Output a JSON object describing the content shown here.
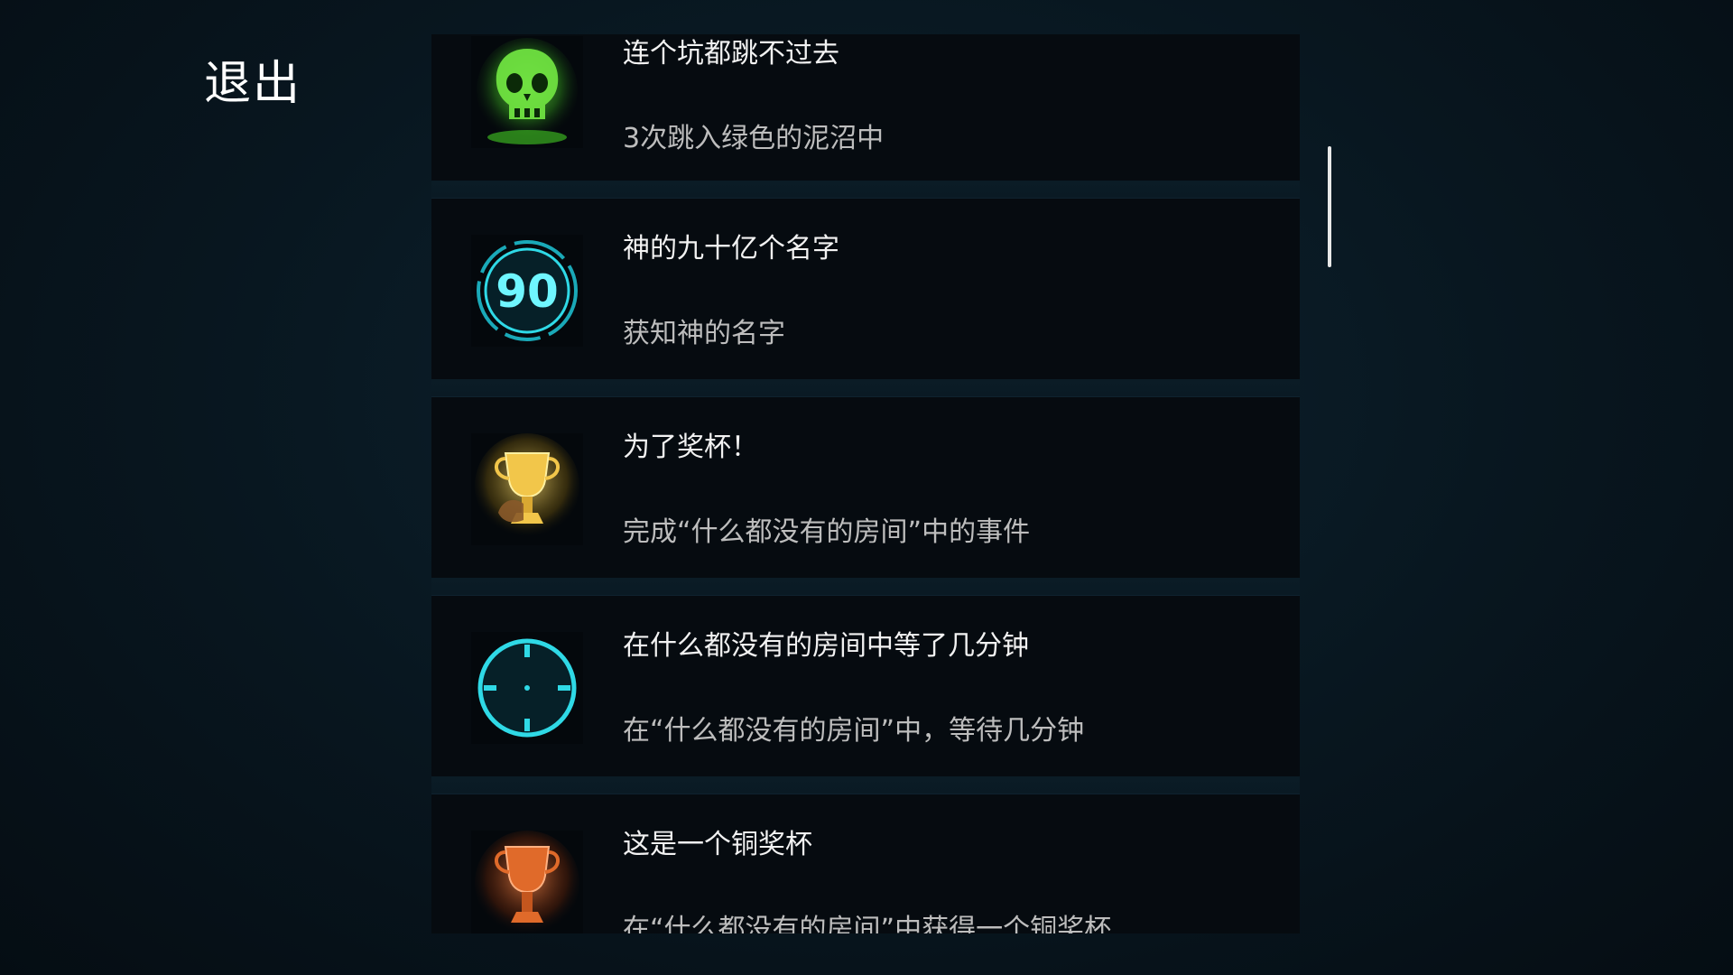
{
  "header": {
    "exit_label": "退出"
  },
  "achievements": [
    {
      "title": "连个坑都跳不过去",
      "description": "3次跳入绿色的泥沼中",
      "icon": "green-skull-icon"
    },
    {
      "title": "神的九十亿个名字",
      "description": "获知神的名字",
      "icon": "counter-90-icon",
      "icon_text": "90"
    },
    {
      "title": "为了奖杯！",
      "description": "完成“什么都没有的房间”中的事件",
      "icon": "gold-trophy-icon"
    },
    {
      "title": "在什么都没有的房间中等了几分钟",
      "description": "在“什么都没有的房间”中，等待几分钟",
      "icon": "clock-icon"
    },
    {
      "title": "这是一个铜奖杯",
      "description": "在“什么都没有的房间”中获得一个铜奖杯",
      "icon": "bronze-trophy-icon"
    }
  ],
  "colors": {
    "background": "#08161f",
    "card": "#060b10",
    "title_text": "#f2f2f2",
    "desc_text": "#bdbdbd",
    "skull_green": "#5fd63a",
    "cyan": "#2fd9e6",
    "gold": "#e0b53a",
    "bronze": "#e06a2a"
  }
}
